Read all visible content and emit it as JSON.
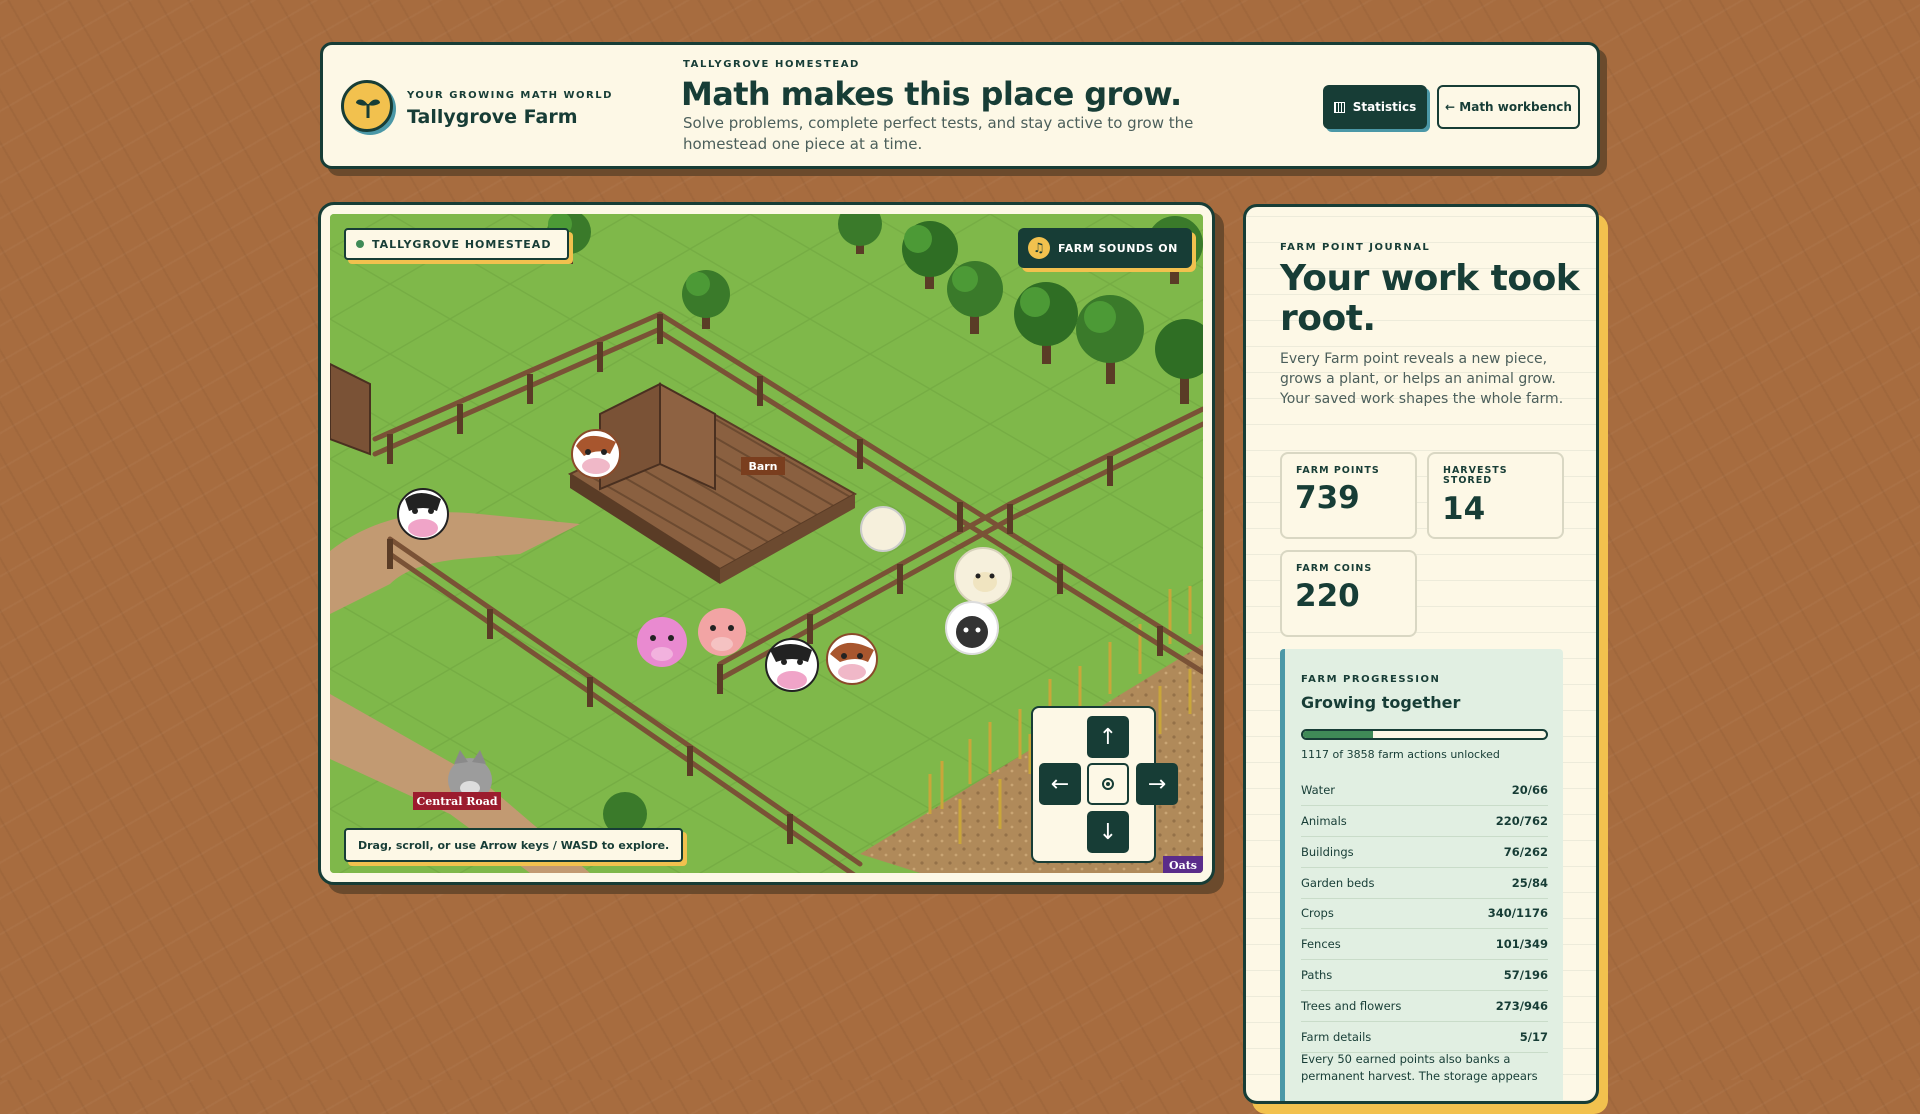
{
  "header": {
    "brand_eyebrow": "YOUR GROWING MATH WORLD",
    "brand_name": "Tallygrove Farm",
    "eyebrow": "TALLYGROVE HOMESTEAD",
    "title": "Math makes this place grow.",
    "subtitle": "Solve problems, complete perfect tests, and stay active to grow the homestead one piece at a time.",
    "statistics_label": "Statistics",
    "workbench_label": "← Math workbench"
  },
  "farm": {
    "homestead_label": "TALLYGROVE HOMESTEAD",
    "sounds_label": "FARM SOUNDS ON",
    "barn_label": "Barn",
    "road_label": "Central Road",
    "crop_label": "Oats",
    "hint": "Drag, scroll, or use Arrow keys / WASD to explore.",
    "dpad": {
      "up": "↑",
      "left": "←",
      "right": "→",
      "down": "↓"
    }
  },
  "journal": {
    "eyebrow": "FARM POINT JOURNAL",
    "title": "Your work took root.",
    "body": "Every Farm point reveals a new piece, grows a plant, or helps an animal grow. Your saved work shapes the whole farm.",
    "stats": [
      {
        "label": "FARM POINTS",
        "value": "739"
      },
      {
        "label": "HARVESTS STORED",
        "value": "14"
      },
      {
        "label": "FARM COINS",
        "value": "220"
      }
    ],
    "progression": {
      "eyebrow": "FARM PROGRESSION",
      "title": "Growing together",
      "unlocked": 1117,
      "total": 3858,
      "caption": "1117 of 3858 farm actions unlocked",
      "rows": [
        {
          "name": "Water",
          "value": "20/66"
        },
        {
          "name": "Animals",
          "value": "220/762"
        },
        {
          "name": "Buildings",
          "value": "76/262"
        },
        {
          "name": "Garden beds",
          "value": "25/84"
        },
        {
          "name": "Crops",
          "value": "340/1176"
        },
        {
          "name": "Fences",
          "value": "101/349"
        },
        {
          "name": "Paths",
          "value": "57/196"
        },
        {
          "name": "Trees and flowers",
          "value": "273/946"
        },
        {
          "name": "Farm details",
          "value": "5/17"
        }
      ],
      "note": "Every 50 earned points also banks a permanent harvest. The storage appears"
    }
  },
  "colors": {
    "background": "#a76c3f",
    "ink": "#173d36",
    "paper": "#fdf8e6",
    "accent_yellow": "#f2c14e",
    "accent_teal": "#4b98a7",
    "grass": "#7fb84a",
    "progress_fill": "#3f8a57"
  }
}
